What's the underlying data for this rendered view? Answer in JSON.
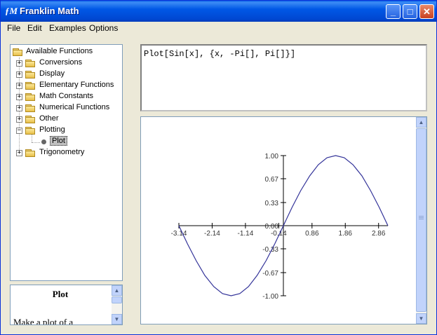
{
  "window": {
    "icon_glyph": "ƒM",
    "title": "Franklin Math",
    "controls": {
      "minimize": "_",
      "maximize": "□",
      "close": "✕"
    }
  },
  "menu": [
    "File",
    "Edit",
    "Examples",
    "Options"
  ],
  "tree": {
    "root": "Available Functions",
    "items": [
      {
        "label": "Conversions",
        "expander": "+"
      },
      {
        "label": "Display",
        "expander": "+"
      },
      {
        "label": "Elementary Functions",
        "expander": "+"
      },
      {
        "label": "Math Constants",
        "expander": "+"
      },
      {
        "label": "Numerical Functions",
        "expander": "+"
      },
      {
        "label": "Other",
        "expander": "+"
      },
      {
        "label": "Plotting",
        "expander": "−"
      },
      {
        "label": "Plot",
        "leaf": true,
        "selected": true
      },
      {
        "label": "Trigonometry",
        "expander": "+"
      }
    ]
  },
  "help": {
    "title": "Plot",
    "body": "Make a plot of a"
  },
  "command": {
    "text": "Plot[Sin[x], {x, -Pi[], Pi[]}]"
  },
  "chart_data": {
    "type": "line",
    "function": "sin(x)",
    "xlim": [
      -3.14,
      3.14
    ],
    "ylim": [
      -1.0,
      1.0
    ],
    "x_ticks": [
      "-3.14",
      "-2.14",
      "-1.14",
      "-0.14",
      "0.86",
      "1.86",
      "2.86"
    ],
    "x_tick_values": [
      -3.14,
      -2.14,
      -1.14,
      -0.14,
      0.86,
      1.86,
      2.86
    ],
    "y_ticks": [
      "1.00",
      "0.67",
      "0.33",
      "0.00",
      "-0.33",
      "-0.67",
      "-1.00"
    ],
    "y_tick_values": [
      1.0,
      0.67,
      0.33,
      0.0,
      -0.33,
      -0.67,
      -1.0
    ],
    "series": [
      {
        "color": "#333399",
        "x": [
          -3.14,
          -2.88,
          -2.62,
          -2.36,
          -2.09,
          -1.83,
          -1.57,
          -1.31,
          -1.05,
          -0.79,
          -0.52,
          -0.26,
          0.0,
          0.26,
          0.52,
          0.79,
          1.05,
          1.31,
          1.57,
          1.83,
          2.09,
          2.36,
          2.62,
          2.88,
          3.14
        ],
        "y": [
          0.0,
          -0.26,
          -0.5,
          -0.71,
          -0.87,
          -0.97,
          -1.0,
          -0.97,
          -0.87,
          -0.71,
          -0.5,
          -0.26,
          0.0,
          0.26,
          0.5,
          0.71,
          0.87,
          0.97,
          1.0,
          0.97,
          0.87,
          0.71,
          0.5,
          0.26,
          0.0
        ]
      }
    ]
  }
}
